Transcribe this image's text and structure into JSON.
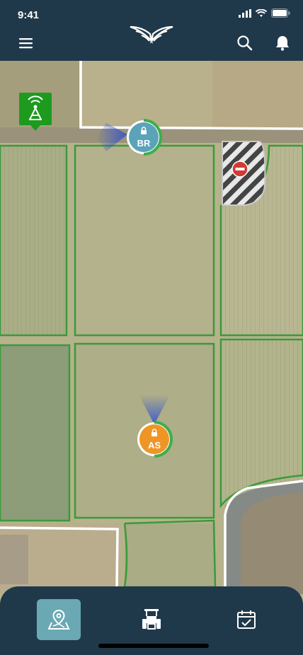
{
  "status_bar": {
    "time": "9:41"
  },
  "header": {
    "menu_icon": "hamburger-menu-icon",
    "logo_icon": "wings-logo-icon",
    "search_icon": "search-icon",
    "notification_icon": "bell-icon"
  },
  "map": {
    "markers": [
      {
        "label": "BR",
        "color": "#5ba3b8",
        "icon": "lock-icon"
      },
      {
        "label": "AS",
        "color": "#ee9526",
        "icon": "lock-icon"
      }
    ],
    "tower_icon": "radio-tower-icon",
    "restricted_icon": "no-entry-icon",
    "field_border_color": "#3a9a3a"
  },
  "bottom_nav": {
    "items": [
      {
        "icon": "map-pin-icon",
        "active": true
      },
      {
        "icon": "tractor-icon",
        "active": false
      },
      {
        "icon": "calendar-check-icon",
        "active": false
      }
    ]
  }
}
